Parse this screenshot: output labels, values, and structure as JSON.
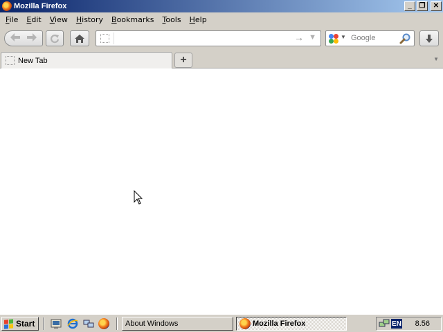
{
  "window": {
    "title": "Mozilla Firefox",
    "buttons": {
      "minimize": "_",
      "restore": "❐",
      "close": "✕"
    }
  },
  "menubar": {
    "items": [
      {
        "label": "File",
        "accel": "F",
        "rest": "ile"
      },
      {
        "label": "Edit",
        "accel": "E",
        "rest": "dit"
      },
      {
        "label": "View",
        "accel": "V",
        "rest": "iew"
      },
      {
        "label": "History",
        "accel": "H",
        "rest": "istory"
      },
      {
        "label": "Bookmarks",
        "accel": "B",
        "rest": "ookmarks"
      },
      {
        "label": "Tools",
        "accel": "T",
        "rest": "ools"
      },
      {
        "label": "Help",
        "accel": "H",
        "rest": "elp"
      }
    ]
  },
  "navbar": {
    "back_icon": "back-arrow-icon",
    "forward_icon": "forward-arrow-icon",
    "url_value": "",
    "go_arrow": "→",
    "dropdown": "▼",
    "search_placeholder": "Google",
    "download_glyph": "⬇"
  },
  "tabs": {
    "items": [
      {
        "label": "New Tab"
      }
    ],
    "new_tab_label": "+",
    "all_tabs_glyph": "▼"
  },
  "taskbar": {
    "start_label": "Start",
    "tasks": [
      {
        "label": "About Windows",
        "active": false
      },
      {
        "label": "Mozilla Firefox",
        "active": true
      }
    ],
    "tray": {
      "lang": "EN",
      "clock": "8.56"
    }
  },
  "colors": {
    "titlebar_start": "#0a246a",
    "titlebar_end": "#a6caf0",
    "chrome": "#d4d0c8"
  }
}
